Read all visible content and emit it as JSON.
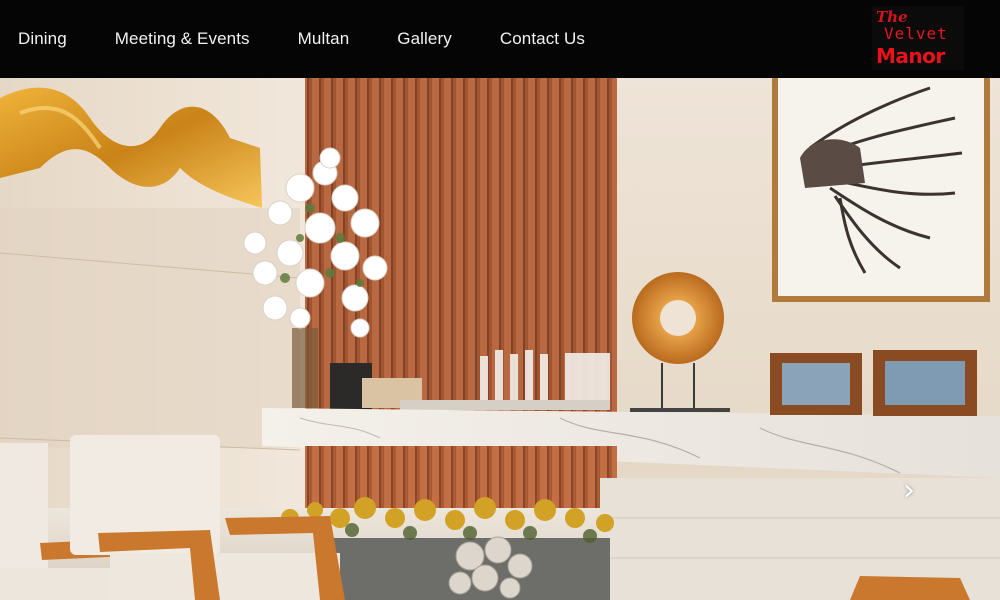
{
  "nav": {
    "items": [
      "Dining",
      "Meeting & Events",
      "Multan",
      "Gallery",
      "Contact Us"
    ]
  },
  "logo": {
    "line1": "The",
    "line2": "Velvet",
    "line3": "Manor"
  },
  "hero": {
    "next_icon": "chevron-right-icon",
    "next_glyph": "›"
  },
  "colors": {
    "nav_bg": "#050505",
    "nav_text": "#f2f2f2",
    "logo_red": "#e11a22",
    "wood_slat": "#b9633a",
    "gold_ribbon": "#d9961c"
  }
}
